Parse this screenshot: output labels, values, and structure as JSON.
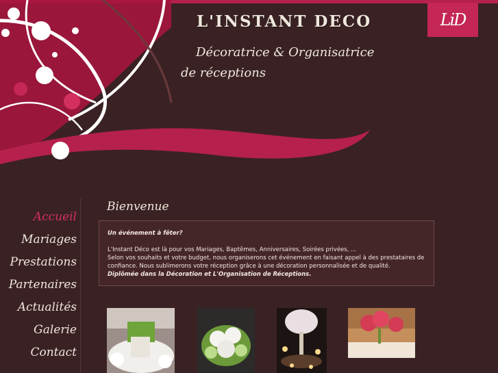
{
  "header": {
    "site_title": "L'INSTANT DECO",
    "subtitle_line1": "Décoratrice & Organisatrice",
    "subtitle_line2": "de réceptions",
    "logo_text": "LiD"
  },
  "nav": {
    "items": [
      {
        "label": "Accueil",
        "active": true
      },
      {
        "label": "Mariages",
        "active": false
      },
      {
        "label": "Prestations",
        "active": false
      },
      {
        "label": "Partenaires",
        "active": false
      },
      {
        "label": "Actualités",
        "active": false
      },
      {
        "label": "Galerie",
        "active": false
      },
      {
        "label": "Contact",
        "active": false
      }
    ]
  },
  "main": {
    "title": "Bienvenue",
    "intro_heading": "Un événement à fêter?",
    "paragraph1": "L'Instant Déco est là pour vos Mariages, Baptêmes, Anniversaires, Soirées privées, ...",
    "paragraph2": "Selon vos souhaits et votre budget, nous organiserons cet événement en faisant appel à des prestataires de confiance. Nous sublimerons votre réception grâce à une décoration personnalisée et de qualité.",
    "paragraph3": "Diplômée dans la Décoration et L'Organisation de Réceptions."
  },
  "colors": {
    "background": "#3a2224",
    "accent": "#c42656",
    "active_nav": "#d52e63",
    "text": "#f0e6dc"
  }
}
